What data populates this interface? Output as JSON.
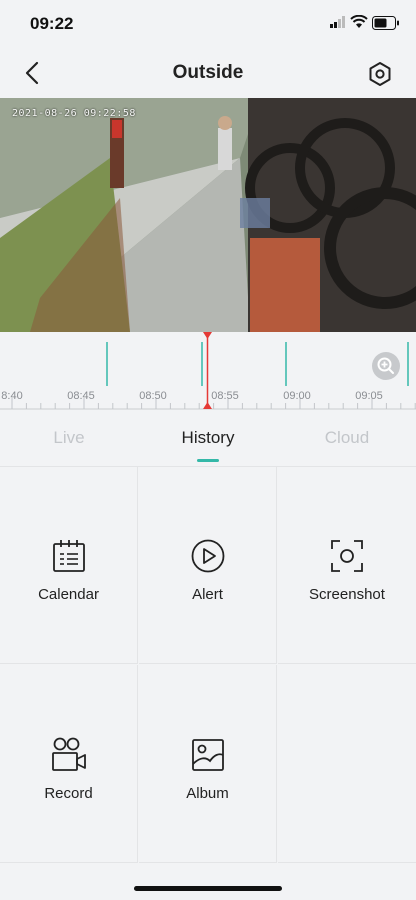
{
  "status_bar": {
    "time": "09:22"
  },
  "header": {
    "title": "Outside"
  },
  "video": {
    "timestamp": "2021-08-26 09:22:58"
  },
  "timeline": {
    "labels": [
      "8:40",
      "08:45",
      "08:50",
      "08:55",
      "09:00",
      "09:05"
    ],
    "colors": {
      "event": "#34b8a8",
      "cursor": "#e53935"
    }
  },
  "tabs": [
    {
      "label": "Live",
      "active": false
    },
    {
      "label": "History",
      "active": true
    },
    {
      "label": "Cloud",
      "active": false
    }
  ],
  "actions": [
    {
      "label": "Calendar",
      "icon": "calendar-icon"
    },
    {
      "label": "Alert",
      "icon": "play-circle-icon"
    },
    {
      "label": "Screenshot",
      "icon": "screenshot-icon"
    },
    {
      "label": "Record",
      "icon": "video-camera-icon"
    },
    {
      "label": "Album",
      "icon": "album-icon"
    }
  ]
}
